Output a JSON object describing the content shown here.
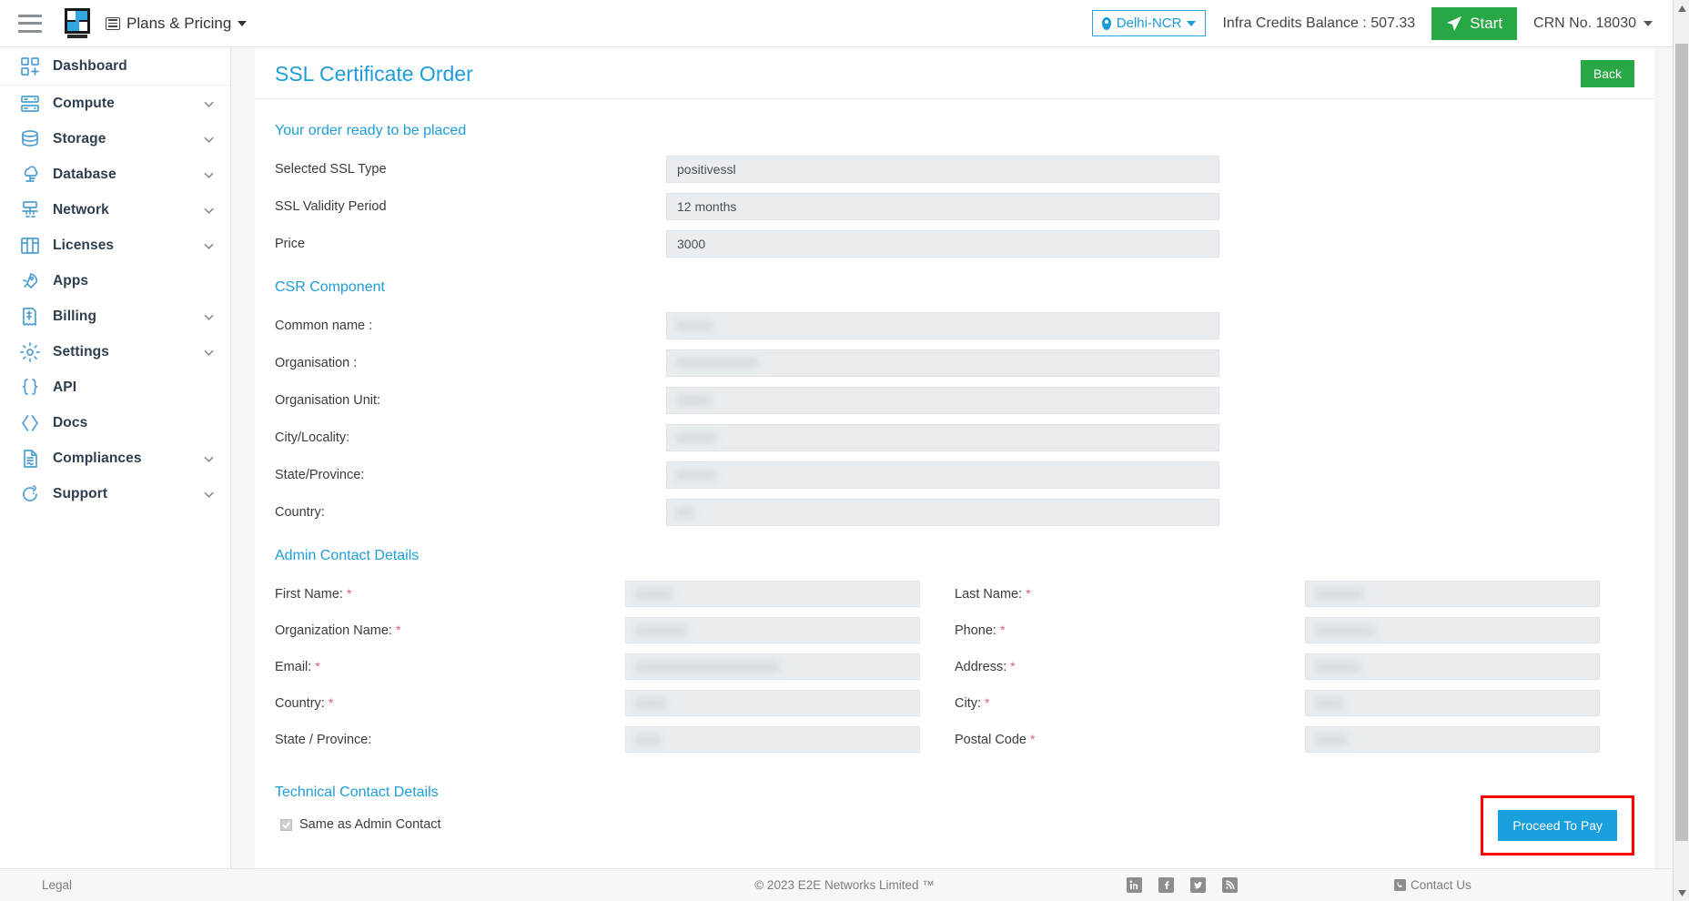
{
  "topbar": {
    "menu_icon": "hamburger-icon",
    "logo_alt": "E2E Networks",
    "plans_label": "Plans & Pricing",
    "region": "Delhi-NCR",
    "credits": "Infra Credits Balance : 507.33",
    "start_label": "Start",
    "crn": "CRN No. 18030"
  },
  "sidebar": {
    "items": [
      {
        "label": "Dashboard",
        "icon": "dashboard-icon",
        "expandable": false
      },
      {
        "label": "Compute",
        "icon": "compute-icon",
        "expandable": true
      },
      {
        "label": "Storage",
        "icon": "storage-icon",
        "expandable": true
      },
      {
        "label": "Database",
        "icon": "database-icon",
        "expandable": true
      },
      {
        "label": "Network",
        "icon": "network-icon",
        "expandable": true
      },
      {
        "label": "Licenses",
        "icon": "licenses-icon",
        "expandable": true
      },
      {
        "label": "Apps",
        "icon": "apps-rocket-icon",
        "expandable": false
      },
      {
        "label": "Billing",
        "icon": "billing-icon",
        "expandable": true
      },
      {
        "label": "Settings",
        "icon": "gear-icon",
        "expandable": true
      },
      {
        "label": "API",
        "icon": "braces-icon",
        "expandable": false
      },
      {
        "label": "Docs",
        "icon": "chevrons-icon",
        "expandable": false
      },
      {
        "label": "Compliances",
        "icon": "compliance-doc-icon",
        "expandable": true
      },
      {
        "label": "Support",
        "icon": "support-icon",
        "expandable": true
      }
    ]
  },
  "page": {
    "title": "SSL Certificate Order",
    "back_label": "Back",
    "order_heading": "Your order ready to be placed",
    "order_fields": [
      {
        "label": "Selected SSL Type",
        "value": "positivessl"
      },
      {
        "label": "SSL Validity Period",
        "value": "12 months"
      },
      {
        "label": "Price",
        "value": "3000"
      }
    ],
    "csr_heading": "CSR Component",
    "csr_fields": [
      {
        "label": "Common name :",
        "value": "",
        "redacted": true,
        "redact_w": 42
      },
      {
        "label": "Organisation :",
        "value": "",
        "redacted": true,
        "redact_w": 92
      },
      {
        "label": "Organisation Unit:",
        "value": "",
        "redacted": true,
        "redact_w": 40
      },
      {
        "label": "City/Locality:",
        "value": "",
        "redacted": true,
        "redact_w": 46
      },
      {
        "label": "State/Province:",
        "value": "",
        "redacted": true,
        "redact_w": 45
      },
      {
        "label": "Country:",
        "value": "",
        "redacted": true,
        "redact_w": 22
      }
    ],
    "admin_heading": "Admin Contact Details",
    "admin_left": [
      {
        "label": "First Name:",
        "required": true,
        "value": "",
        "redacted": true,
        "redact_w": 42
      },
      {
        "label": "Organization Name:",
        "required": true,
        "value": "",
        "redacted": true,
        "redact_w": 58
      },
      {
        "label": "Email:",
        "required": true,
        "value": "",
        "redacted": true,
        "redact_w": 160
      },
      {
        "label": "Country:",
        "required": true,
        "value": "",
        "redacted": true,
        "redact_w": 36
      },
      {
        "label": "State / Province:",
        "required": false,
        "value": "",
        "redacted": true,
        "redact_w": 30
      }
    ],
    "admin_right": [
      {
        "label": "Last Name:",
        "required": true,
        "value": "",
        "redacted": true,
        "redact_w": 54
      },
      {
        "label": "Phone:",
        "required": true,
        "value": "",
        "redacted": true,
        "redact_w": 68
      },
      {
        "label": "Address:",
        "required": true,
        "value": "",
        "redacted": true,
        "redact_w": 52
      },
      {
        "label": "City:",
        "required": true,
        "value": "",
        "redacted": true,
        "redact_w": 34
      },
      {
        "label": "Postal Code",
        "required": true,
        "value": "",
        "redacted": true,
        "redact_w": 37
      }
    ],
    "technical_heading": "Technical Contact Details",
    "same_as_admin_label": "Same as Admin Contact",
    "same_as_admin_checked": true,
    "proceed_label": "Proceed To Pay",
    "highlight_color": "#ff0000"
  },
  "footer": {
    "legal": "Legal",
    "copyright": "© 2023 E2E Networks Limited ™",
    "social": [
      "linkedin-icon",
      "facebook-icon",
      "twitter-icon",
      "rss-icon"
    ],
    "contact": "Contact Us"
  },
  "colors": {
    "accent_blue": "#1f9cd8",
    "green": "#28a745",
    "pay_blue": "#1a9fdd",
    "required_red": "#e05a6b",
    "highlight_red": "#ff0000"
  }
}
